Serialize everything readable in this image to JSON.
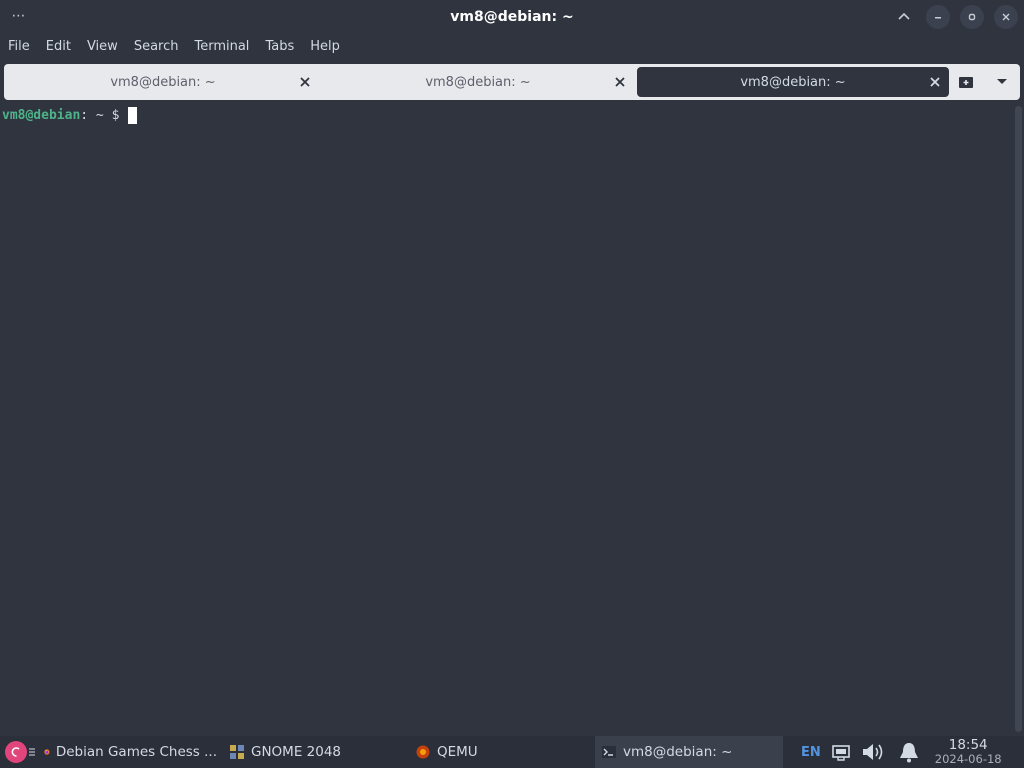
{
  "window": {
    "title": "vm8@debian: ~",
    "menu_dots": "⋯"
  },
  "menu": [
    "File",
    "Edit",
    "View",
    "Search",
    "Terminal",
    "Tabs",
    "Help"
  ],
  "tabs": [
    {
      "label": "vm8@debian: ~",
      "active": false
    },
    {
      "label": "vm8@debian: ~",
      "active": false
    },
    {
      "label": "vm8@debian: ~",
      "active": true
    }
  ],
  "terminal": {
    "user_host": "vm8@debian",
    "rest": ": ~ $ "
  },
  "taskbar": {
    "tasks": [
      {
        "label": "Debian Games Chess ...",
        "icon": "firefox-icon"
      },
      {
        "label": "GNOME 2048",
        "icon": "gnome-2048-icon"
      },
      {
        "label": "QEMU",
        "icon": "qemu-icon"
      },
      {
        "label": "vm8@debian: ~",
        "icon": "terminal-icon",
        "active": true
      }
    ],
    "keyboard": "EN",
    "time": "18:54",
    "date": "2024-06-18"
  },
  "colors": {
    "background": "#2f343f",
    "prompt_user": "#4fb38a",
    "tab_bar": "#e8e9ec",
    "start_button": "#e0457b"
  }
}
